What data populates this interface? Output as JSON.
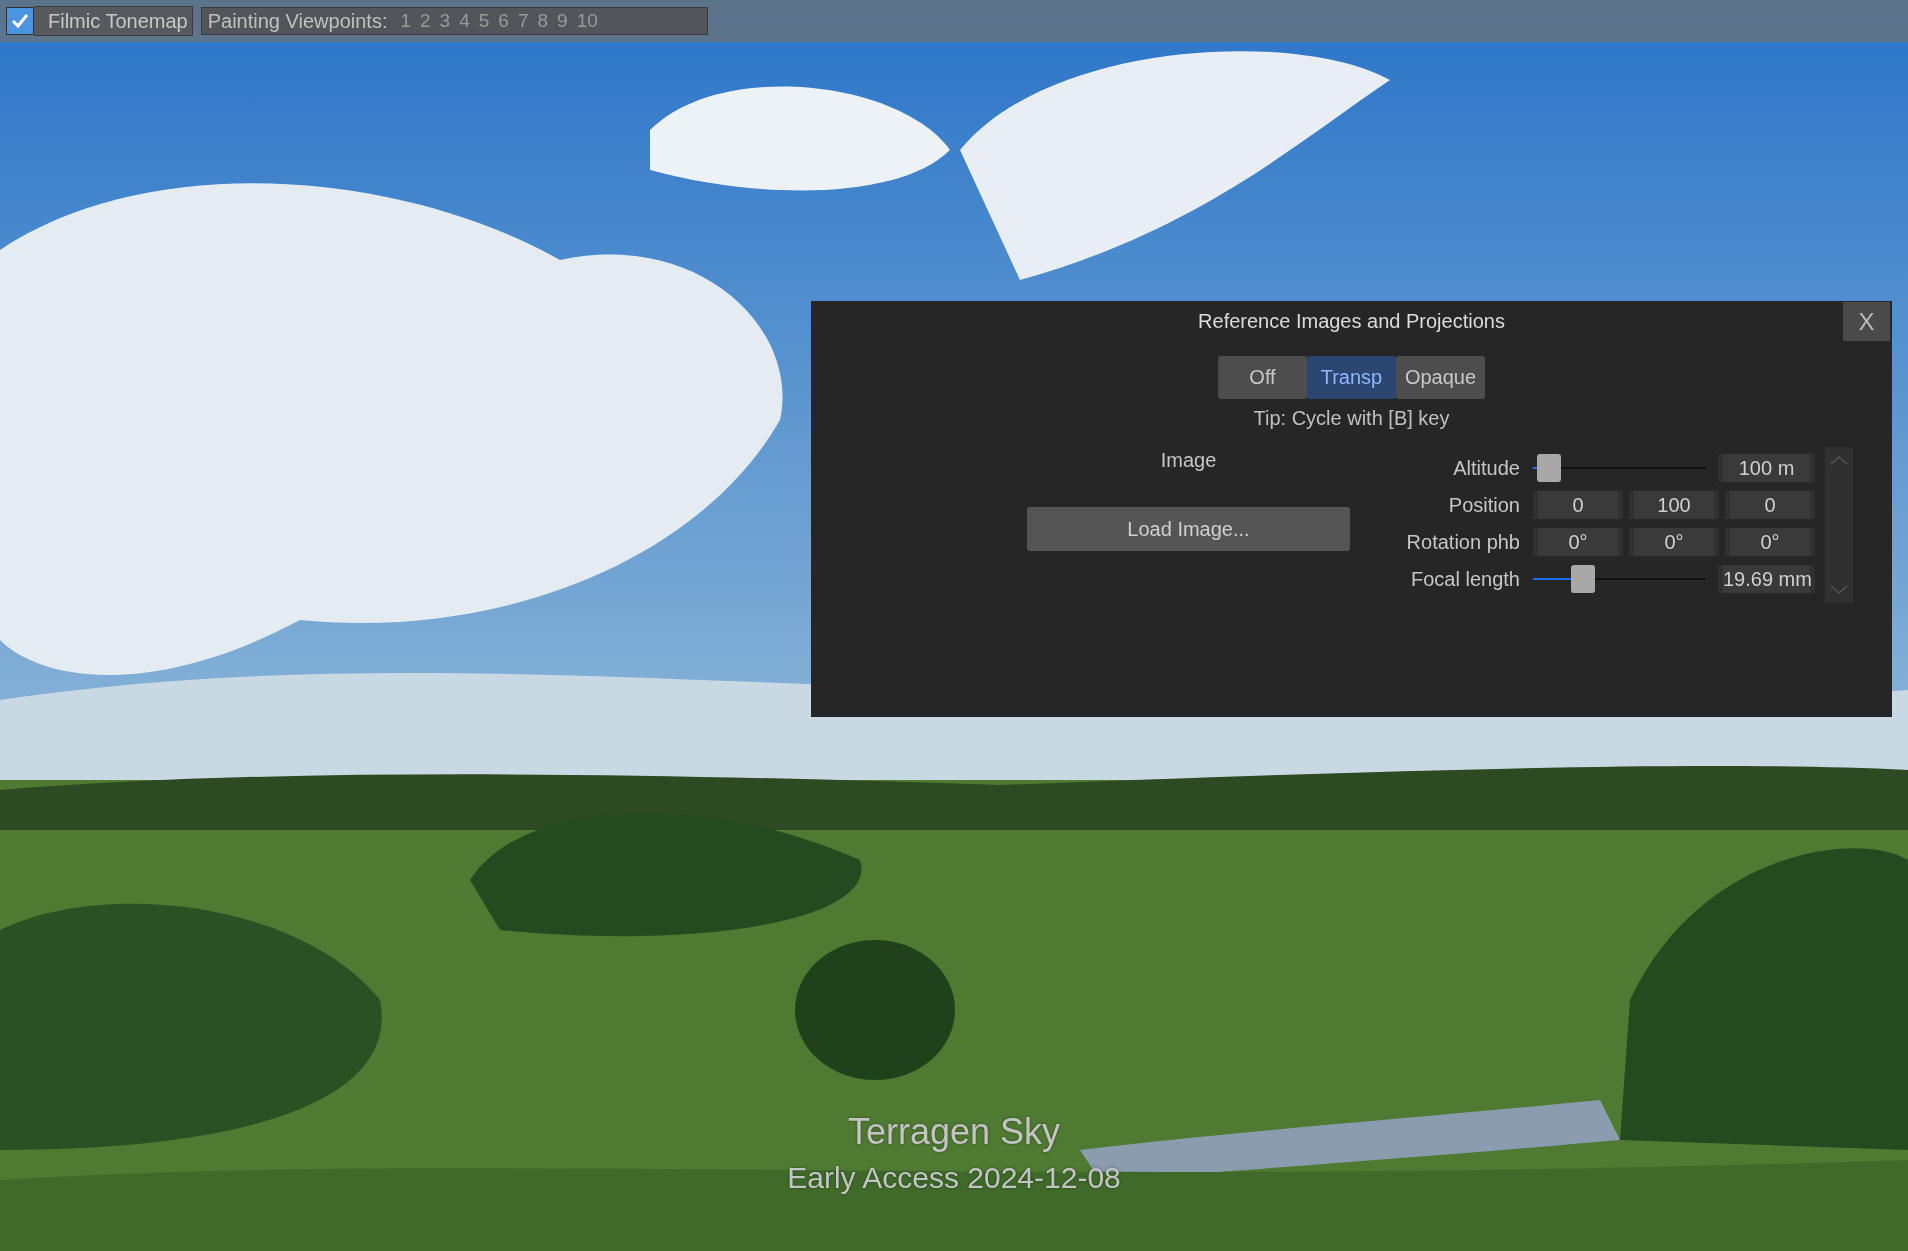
{
  "toolbar": {
    "filmic_tonemap": {
      "label": "Filmic Tonemap",
      "checked": true
    },
    "painting_viewpoints": {
      "label": "Painting Viewpoints:",
      "viewpoints": [
        "1",
        "2",
        "3",
        "4",
        "5",
        "6",
        "7",
        "8",
        "9",
        "10"
      ]
    }
  },
  "dialog": {
    "title": "Reference Images and Projections",
    "close": "X",
    "modes": [
      {
        "label": "Off",
        "selected": false
      },
      {
        "label": "Transp",
        "selected": true
      },
      {
        "label": "Opaque",
        "selected": false
      }
    ],
    "tip": "Tip: Cycle with [B] key",
    "image_label": "Image",
    "load_button": "Load Image...",
    "properties": [
      {
        "kind": "slider",
        "label": "Altitude",
        "level": 0.09,
        "value": "100 m"
      },
      {
        "kind": "triple",
        "label": "Position",
        "values": [
          "0",
          "100",
          "0"
        ]
      },
      {
        "kind": "triple",
        "label": "Rotation phb",
        "values": [
          "0°",
          "0°",
          "0°"
        ]
      },
      {
        "kind": "slider",
        "label": "Focal length",
        "level": 0.29,
        "value": "19.69 mm"
      }
    ]
  },
  "caption": {
    "title": "Terragen Sky",
    "subtitle": "Early Access 2024-12-08"
  }
}
